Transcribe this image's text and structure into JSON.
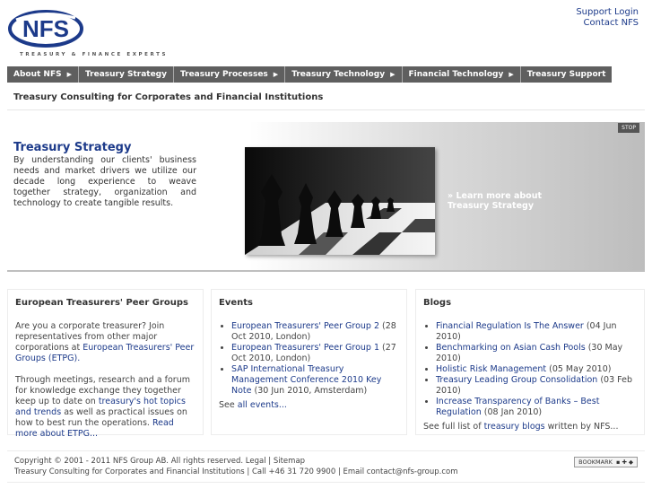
{
  "header": {
    "logo_text": "NFS",
    "tagline": "TREASURY & FINANCE EXPERTS",
    "links": [
      "Support Login",
      "Contact NFS"
    ]
  },
  "nav": [
    {
      "label": "About NFS",
      "submenu": true
    },
    {
      "label": "Treasury Strategy",
      "submenu": false
    },
    {
      "label": "Treasury Processes",
      "submenu": true
    },
    {
      "label": "Treasury Technology",
      "submenu": true
    },
    {
      "label": "Financial Technology",
      "submenu": true
    },
    {
      "label": "Treasury Support",
      "submenu": false
    }
  ],
  "page_tagline": "Treasury Consulting for Corporates and Financial Institutions",
  "hero": {
    "title": "Treasury Strategy",
    "text": "By understanding our clients' business needs and market drivers we utilize our decade long experience to weave together strategy, organization and technology to create tangible results.",
    "link_line1": "» Learn more about",
    "link_line2": "Treasury Strategy",
    "stop_label": "STOP"
  },
  "peer": {
    "title": "European Treasurers' Peer Groups",
    "p1_a": "Are you a corporate treasurer? Join representatives from other major corporations at ",
    "p1_link": "European Treasurers' Peer Groups (ETPG).",
    "p2_a": "Through meetings, research and a forum for knowledge exchange they together keep up to date on ",
    "p2_link1": "treasury's hot topics and trends",
    "p2_b": " as well as practical issues on how to best run the operations. ",
    "p2_link2": "Read more about ETPG..."
  },
  "events": {
    "title": "Events",
    "items": [
      {
        "link": "European Treasurers' Peer Group 2",
        "meta": " (28 Oct 2010, London)"
      },
      {
        "link": "European Treasurers' Peer Group 1",
        "meta": " (27 Oct 2010, London)"
      },
      {
        "link": "SAP International Treasury Management Conference 2010 Key Note",
        "meta": " (30 Jun 2010, Amsterdam)"
      }
    ],
    "see_prefix": "See ",
    "see_link": "all events...",
    "see_suffix": ""
  },
  "blogs": {
    "title": "Blogs",
    "items": [
      {
        "link": "Financial Regulation Is The Answer",
        "meta": " (04 Jun 2010)"
      },
      {
        "link": "Benchmarking on Asian Cash Pools",
        "meta": " (30 May 2010)"
      },
      {
        "link": "Holistic Risk Management",
        "meta": " (05 May 2010)"
      },
      {
        "link": "Treasury Leading Group Consolidation",
        "meta": " (03 Feb 2010)"
      },
      {
        "link": "Increase Transparency of Banks – Best Regulation",
        "meta": " (08 Jan 2010)"
      }
    ],
    "see_prefix": "See full list of ",
    "see_link": "treasury blogs",
    "see_suffix": " written by NFS..."
  },
  "footer": {
    "line1": "Copyright © 2001 - 2011 NFS Group AB. All rights reserved. Legal | Sitemap",
    "line2": "Treasury Consulting for Corporates and Financial Institutions | Call +46 31 720 9900 | Email contact@nfs-group.com",
    "bookmark_label": "BOOKMARK"
  },
  "colors": {
    "link": "#1c3a8a",
    "nav_bg": "#5f5f5f",
    "logo_blue": "#1c3a8a"
  }
}
